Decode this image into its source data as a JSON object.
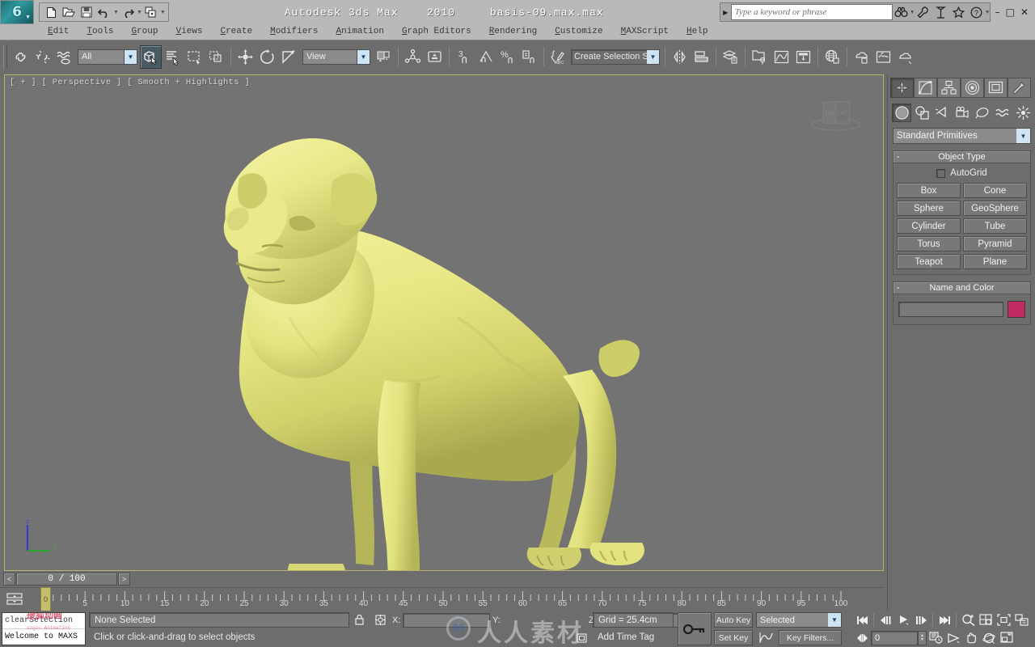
{
  "titlebar": {
    "app_title": "Autodesk 3ds Max",
    "version": "2010",
    "filename": "basis-09.max.max",
    "logo_glyph": "6",
    "quick_icons": [
      "new-file-icon",
      "open-file-icon",
      "save-file-icon",
      "undo-icon",
      "redo-icon",
      "set-project-folder-icon"
    ],
    "search_placeholder": "Type a keyword or phrase",
    "help_icons": [
      "search-binoculars-icon",
      "subscription-wrench-icon",
      "communication-center-icon",
      "favorites-star-icon",
      "help-question-icon"
    ],
    "window_buttons": {
      "minimize": "–",
      "maximize": "□",
      "close": "✕"
    }
  },
  "menu": {
    "items": [
      {
        "label": "Edit"
      },
      {
        "label": "Tools"
      },
      {
        "label": "Group"
      },
      {
        "label": "Views"
      },
      {
        "label": "Create"
      },
      {
        "label": "Modifiers"
      },
      {
        "label": "Animation"
      },
      {
        "label": "Graph Editors"
      },
      {
        "label": "Rendering"
      },
      {
        "label": "Customize"
      },
      {
        "label": "MAXScript"
      },
      {
        "label": "Help"
      }
    ]
  },
  "toolbar": {
    "selection_filter": "All",
    "reference_coord_system": "View",
    "named_selection_set": "Create Selection Set",
    "icons": [
      "select-and-link-icon",
      "unlink-selection-icon",
      "bind-to-space-warp-icon",
      "select-object-icon",
      "select-by-name-icon",
      "rectangular-selection-region-icon",
      "window-crossing-icon",
      "select-and-move-icon",
      "select-and-rotate-icon",
      "select-and-uniform-scale-icon",
      "use-center-flyout-icon",
      "select-and-manipulate-icon",
      "snaps-toggle-icon",
      "angle-snap-toggle-icon",
      "percent-snap-toggle-icon",
      "spinner-snap-toggle-icon",
      "edit-named-selection-sets-icon",
      "mirror-icon",
      "align-icon",
      "layer-manager-icon",
      "curve-editor-icon",
      "schematic-view-icon",
      "material-editor-icon",
      "render-setup-icon",
      "rendered-frame-window-icon",
      "render-production-icon"
    ]
  },
  "viewport": {
    "label": "[ + ] [ Perspective ] [ Smooth + Highlights ]",
    "background_color": "#737373",
    "active_border_color": "#b9b26a",
    "model_name": "dog-mesh",
    "model_color": "#e6e683",
    "axis_labels": {
      "z": "z",
      "y": "y"
    },
    "axis_colors": {
      "z": "#3b3bd0",
      "y": "#2ea02e"
    },
    "viewcube_label": "TOP"
  },
  "timeline": {
    "time_field": "0 / 100",
    "prev_label": "<",
    "next_label": ">",
    "current_frame_marker": "0",
    "range_start": 0,
    "range_end": 100,
    "tick_labels": [
      5,
      10,
      15,
      20,
      25,
      30,
      35,
      40,
      45,
      50,
      55,
      60,
      65,
      70,
      75,
      80,
      85,
      90,
      95,
      100
    ]
  },
  "statusbar": {
    "listener_line1": "clearSelection",
    "listener_line2": "Welcome to MAXS",
    "watermark_red": "搜狐动画",
    "watermark_red_sub": "sogou Animation",
    "selection_status": "None Selected",
    "prompt": "Click or click-and-drag to select objects",
    "coords": {
      "x_label": "X:",
      "y_label": "Y:",
      "z_label": "Z:",
      "x_value": "",
      "y_value": "",
      "z_value": ""
    },
    "grid": "Grid = 25.4cm",
    "add_time_tag": "Add Time Tag",
    "lock_icon": "lock-selection-icon",
    "key_mode_icon": "key-mode-toggle-icon"
  },
  "animation": {
    "auto_key": "Auto Key",
    "set_key": "Set Key",
    "key_filter_mode": "Selected",
    "key_filters": "Key Filters...",
    "current_frame": "0",
    "playback_icons": [
      "go-to-start-icon",
      "previous-frame-icon",
      "play-animation-icon",
      "next-frame-icon",
      "go-to-end-icon"
    ],
    "nav_icons": [
      "zoom-icon",
      "zoom-all-icon",
      "zoom-extents-icon",
      "zoom-region-icon",
      "key-mode-toggle-icon",
      "time-configuration-icon",
      "field-of-view-icon",
      "pan-view-icon",
      "orbit-icon",
      "maximize-viewport-toggle-icon"
    ]
  },
  "command_panel": {
    "tabs": [
      {
        "name": "create",
        "icon": "create-tab-icon",
        "active": true
      },
      {
        "name": "modify",
        "icon": "modify-tab-icon",
        "active": false
      },
      {
        "name": "hierarchy",
        "icon": "hierarchy-tab-icon",
        "active": false
      },
      {
        "name": "motion",
        "icon": "motion-tab-icon",
        "active": false
      },
      {
        "name": "display",
        "icon": "display-tab-icon",
        "active": false
      },
      {
        "name": "utilities",
        "icon": "utilities-tab-icon",
        "active": false
      }
    ],
    "categories": [
      {
        "name": "geometry",
        "icon": "geometry-category-icon",
        "active": true
      },
      {
        "name": "shapes",
        "icon": "shapes-category-icon",
        "active": false
      },
      {
        "name": "lights",
        "icon": "lights-category-icon",
        "active": false
      },
      {
        "name": "cameras",
        "icon": "cameras-category-icon",
        "active": false
      },
      {
        "name": "helpers",
        "icon": "helpers-category-icon",
        "active": false
      },
      {
        "name": "space-warps",
        "icon": "space-warps-category-icon",
        "active": false
      },
      {
        "name": "systems",
        "icon": "systems-category-icon",
        "active": false
      }
    ],
    "subcategory": "Standard Primitives",
    "object_type": {
      "title": "Object Type",
      "autogrid_label": "AutoGrid",
      "autogrid_checked": false,
      "buttons": [
        "Box",
        "Cone",
        "Sphere",
        "GeoSphere",
        "Cylinder",
        "Tube",
        "Torus",
        "Pyramid",
        "Teapot",
        "Plane"
      ]
    },
    "name_and_color": {
      "title": "Name and Color",
      "name_value": "",
      "color": "#c42a63"
    }
  },
  "watermark": {
    "circle_text": "M",
    "text": "人人素材"
  }
}
